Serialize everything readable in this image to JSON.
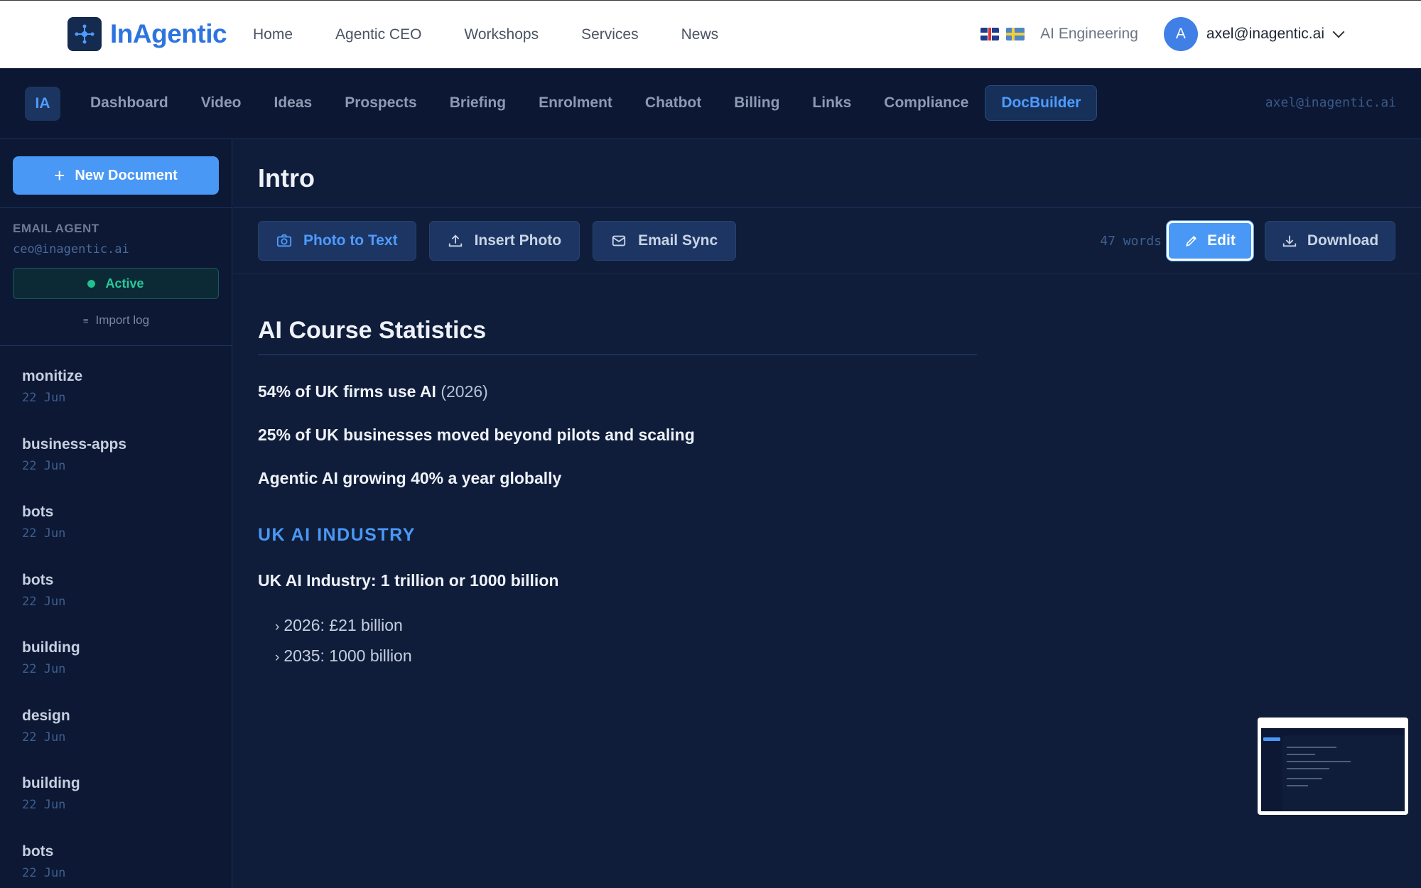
{
  "site": {
    "brand": "InAgentic",
    "nav": [
      "Home",
      "Agentic CEO",
      "Workshops",
      "Services",
      "News"
    ],
    "ai_engineering": "AI Engineering",
    "avatar_initial": "A",
    "user_email": "axel@inagentic.ai"
  },
  "app_nav": {
    "badge": "IA",
    "tabs": [
      "Dashboard",
      "Video",
      "Ideas",
      "Prospects",
      "Briefing",
      "Enrolment",
      "Chatbot",
      "Billing",
      "Links",
      "Compliance",
      "DocBuilder"
    ],
    "active_tab": "DocBuilder",
    "email": "axel@inagentic.ai"
  },
  "sidebar": {
    "new_document_label": "New Document",
    "email_agent_label": "EMAIL AGENT",
    "agent_email": "ceo@inagentic.ai",
    "status": "Active",
    "import_log_label": "Import log",
    "documents": [
      {
        "name": "monitize",
        "date": "22 Jun"
      },
      {
        "name": "business-apps",
        "date": "22 Jun"
      },
      {
        "name": "bots",
        "date": "22 Jun"
      },
      {
        "name": "bots",
        "date": "22 Jun"
      },
      {
        "name": "building",
        "date": "22 Jun"
      },
      {
        "name": "design",
        "date": "22 Jun"
      },
      {
        "name": "building",
        "date": "22 Jun"
      },
      {
        "name": "bots",
        "date": "22 Jun"
      }
    ]
  },
  "main": {
    "title": "Intro",
    "toolbar": {
      "photo_to_text": "Photo to Text",
      "insert_photo": "Insert Photo",
      "email_sync": "Email Sync",
      "word_count": "47 words",
      "edit": "Edit",
      "download": "Download"
    },
    "document": {
      "heading": "AI Course Statistics",
      "stat1_bold": "54% of UK firms use AI",
      "stat1_light": "(2026)",
      "stat2": "25% of UK businesses moved beyond pilots and scaling",
      "stat3": "Agentic AI growing 40% a year globally",
      "section_heading": "UK AI INDUSTRY",
      "industry_line": "UK AI Industry: 1 trillion or 1000 billion",
      "bullets": [
        "2026: £21 billion",
        "2035: 1000 billion"
      ]
    }
  },
  "colors": {
    "accent": "#4a98f5",
    "background": "#0f1d3a",
    "nav_background": "#0b1733",
    "active_status": "#22c08f"
  }
}
